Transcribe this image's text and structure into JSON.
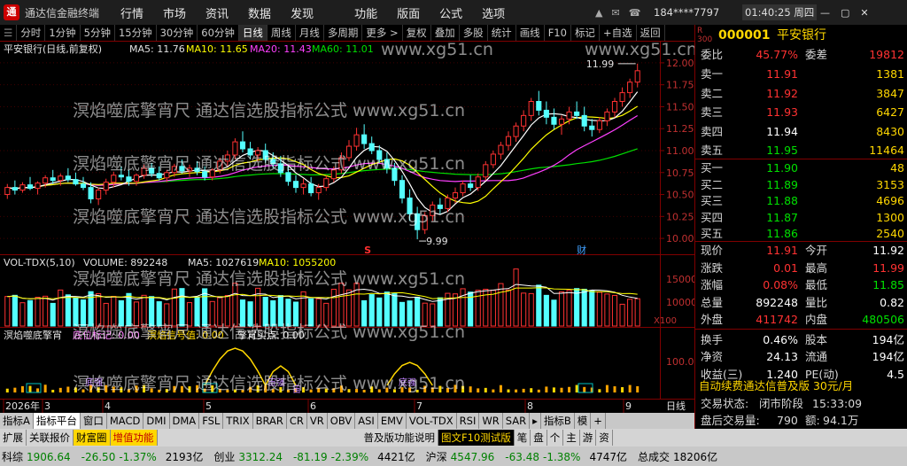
{
  "app": {
    "logo": "通",
    "title": "通达信金融终端",
    "menu": [
      "行情",
      "市场",
      "资讯",
      "数据",
      "发现",
      "功能",
      "版面",
      "公式",
      "选项"
    ],
    "account": "184****7797",
    "time": "01:40:25 周四"
  },
  "toolbar": {
    "buttons": [
      "分时",
      "1分钟",
      "5分钟",
      "15分钟",
      "30分钟",
      "60分钟",
      "日线",
      "周线",
      "月线",
      "多周期",
      "更多 >",
      "复权",
      "叠加",
      "多股",
      "统计",
      "画线",
      "F10",
      "标记",
      "+自选",
      "返回"
    ],
    "active": "日线"
  },
  "chart": {
    "header": "平安银行(日线,前复权)",
    "ma5": "MA5: 11.76",
    "ma10": "MA10: 11.65",
    "ma20": "MA20: 11.43",
    "ma60": "MA60: 11.01",
    "y_ticks": [
      "12.00",
      "11.75",
      "11.50",
      "11.25",
      "11.00",
      "10.75",
      "10.50",
      "10.25",
      "10.00"
    ],
    "high_label": "11.99",
    "low_label": "9.99",
    "marker_s": "S",
    "marker_cai": "财",
    "vol_header": "VOL-TDX(5,10)",
    "vol_value": "VOLUME: 892248",
    "vol_ma5": "MA5: 1027619",
    "vol_ma10": "MA10: 1055200",
    "vol_ticks": [
      "15000",
      "10000",
      "X100"
    ],
    "ind_header": "溟焰噬底擎宵",
    "ind_p1": "底位标记: 0.00",
    "ind_p2": "溟焰信号值: 0.00",
    "ind_p3": "擎宵买点: 0.00",
    "ind_ticks": [
      "100.0"
    ],
    "x_labels": [
      "2026年",
      "3",
      "4",
      "5",
      "6",
      "7",
      "8",
      "9"
    ],
    "x_right": "日线",
    "ind_tags": [
      "底强",
      "宙强",
      "宙",
      "底强"
    ]
  },
  "watermark": {
    "text": "溟焰噬底擎宵尺 通达信选股指标公式 www.xg51.cn",
    "short": "www.xg51.cn"
  },
  "chart_data": {
    "type": "candlestick",
    "title": "平安银行(日线,前复权)",
    "ylim": [
      9.9,
      12.1
    ],
    "ma": {
      "MA5": 11.76,
      "MA10": 11.65,
      "MA20": 11.43,
      "MA60": 11.01
    },
    "ohlc": [
      [
        10.5,
        10.62,
        10.45,
        10.58
      ],
      [
        10.58,
        10.66,
        10.5,
        10.55
      ],
      [
        10.55,
        10.64,
        10.52,
        10.61
      ],
      [
        10.61,
        10.7,
        10.55,
        10.57
      ],
      [
        10.57,
        10.65,
        10.5,
        10.63
      ],
      [
        10.63,
        10.72,
        10.58,
        10.69
      ],
      [
        10.69,
        10.78,
        10.62,
        10.66
      ],
      [
        10.66,
        10.74,
        10.6,
        10.71
      ],
      [
        10.71,
        10.8,
        10.64,
        10.67
      ],
      [
        10.67,
        10.75,
        10.6,
        10.62
      ],
      [
        10.62,
        10.7,
        10.55,
        10.58
      ],
      [
        10.58,
        10.64,
        10.4,
        10.45
      ],
      [
        10.45,
        10.58,
        10.38,
        10.55
      ],
      [
        10.55,
        10.68,
        10.5,
        10.64
      ],
      [
        10.64,
        10.76,
        10.58,
        10.72
      ],
      [
        10.72,
        10.82,
        10.66,
        10.7
      ],
      [
        10.7,
        10.78,
        10.6,
        10.65
      ],
      [
        10.65,
        10.74,
        10.6,
        10.72
      ],
      [
        10.72,
        10.84,
        10.68,
        10.8
      ],
      [
        10.8,
        10.86,
        10.7,
        10.74
      ],
      [
        10.74,
        10.82,
        10.66,
        10.69
      ],
      [
        10.69,
        10.78,
        10.64,
        10.75
      ],
      [
        10.75,
        10.85,
        10.7,
        10.82
      ],
      [
        10.82,
        10.9,
        10.74,
        10.77
      ],
      [
        10.77,
        10.84,
        10.7,
        10.8
      ],
      [
        10.8,
        10.88,
        10.72,
        10.76
      ],
      [
        10.76,
        10.82,
        10.66,
        10.7
      ],
      [
        10.7,
        10.8,
        10.66,
        10.78
      ],
      [
        10.78,
        10.92,
        10.74,
        10.88
      ],
      [
        10.88,
        11.0,
        10.82,
        10.95
      ],
      [
        10.95,
        11.14,
        10.9,
        11.1
      ],
      [
        11.1,
        11.22,
        10.98,
        11.02
      ],
      [
        11.02,
        11.1,
        10.9,
        10.95
      ],
      [
        10.95,
        11.04,
        10.88,
        11.0
      ],
      [
        11.0,
        11.08,
        10.86,
        10.9
      ],
      [
        10.9,
        10.98,
        10.8,
        10.85
      ],
      [
        10.85,
        10.94,
        10.7,
        10.75
      ],
      [
        10.75,
        10.82,
        10.6,
        10.65
      ],
      [
        10.65,
        10.72,
        10.52,
        10.58
      ],
      [
        10.58,
        10.68,
        10.5,
        10.62
      ],
      [
        10.62,
        10.7,
        10.48,
        10.52
      ],
      [
        10.52,
        10.62,
        10.44,
        10.58
      ],
      [
        10.58,
        10.72,
        10.54,
        10.68
      ],
      [
        10.68,
        10.82,
        10.64,
        10.78
      ],
      [
        10.78,
        10.98,
        10.74,
        10.92
      ],
      [
        10.92,
        11.12,
        10.88,
        11.05
      ],
      [
        11.05,
        11.26,
        11.0,
        11.18
      ],
      [
        11.18,
        11.3,
        11.02,
        11.08
      ],
      [
        11.08,
        11.16,
        10.96,
        11.0
      ],
      [
        11.0,
        11.06,
        10.86,
        10.9
      ],
      [
        10.9,
        10.98,
        10.74,
        10.8
      ],
      [
        10.8,
        10.86,
        10.6,
        10.66
      ],
      [
        10.66,
        10.72,
        10.4,
        10.46
      ],
      [
        10.46,
        10.56,
        10.2,
        10.28
      ],
      [
        10.28,
        10.36,
        9.99,
        10.1
      ],
      [
        10.1,
        10.3,
        10.05,
        10.26
      ],
      [
        10.26,
        10.42,
        10.2,
        10.38
      ],
      [
        10.38,
        10.46,
        10.28,
        10.34
      ],
      [
        10.34,
        10.5,
        10.3,
        10.46
      ],
      [
        10.46,
        10.58,
        10.4,
        10.52
      ],
      [
        10.52,
        10.66,
        10.48,
        10.62
      ],
      [
        10.62,
        10.72,
        10.54,
        10.58
      ],
      [
        10.58,
        10.74,
        10.54,
        10.7
      ],
      [
        10.7,
        10.88,
        10.66,
        10.84
      ],
      [
        10.84,
        11.0,
        10.8,
        10.96
      ],
      [
        10.96,
        11.1,
        10.9,
        11.06
      ],
      [
        11.06,
        11.22,
        11.0,
        11.16
      ],
      [
        11.16,
        11.32,
        11.1,
        11.28
      ],
      [
        11.28,
        11.46,
        11.22,
        11.4
      ],
      [
        11.4,
        11.6,
        11.34,
        11.56
      ],
      [
        11.56,
        11.68,
        11.4,
        11.46
      ],
      [
        11.46,
        11.56,
        11.3,
        11.38
      ],
      [
        11.38,
        11.48,
        11.24,
        11.3
      ],
      [
        11.3,
        11.4,
        11.18,
        11.36
      ],
      [
        11.36,
        11.5,
        11.3,
        11.44
      ],
      [
        11.44,
        11.56,
        11.36,
        11.4
      ],
      [
        11.4,
        11.5,
        11.22,
        11.28
      ],
      [
        11.28,
        11.36,
        11.16,
        11.24
      ],
      [
        11.24,
        11.38,
        11.2,
        11.34
      ],
      [
        11.34,
        11.48,
        11.28,
        11.44
      ],
      [
        11.44,
        11.6,
        11.38,
        11.56
      ],
      [
        11.56,
        11.72,
        11.5,
        11.66
      ],
      [
        11.66,
        11.82,
        11.6,
        11.78
      ],
      [
        11.78,
        11.99,
        11.72,
        11.91
      ]
    ]
  },
  "quote": {
    "code": "000001",
    "name": "平安银行",
    "weibi_label": "委比",
    "weibi": "45.77%",
    "weicha_label": "委差",
    "weicha": "19812",
    "sell": [
      {
        "label": "卖五",
        "price": "11.95",
        "vol": "11464"
      },
      {
        "label": "卖四",
        "price": "11.94",
        "vol": "8430"
      },
      {
        "label": "卖三",
        "price": "11.93",
        "vol": "6427"
      },
      {
        "label": "卖二",
        "price": "11.92",
        "vol": "3847"
      },
      {
        "label": "卖一",
        "price": "11.91",
        "vol": "1381"
      }
    ],
    "buy": [
      {
        "label": "买一",
        "price": "11.90",
        "vol": "48"
      },
      {
        "label": "买二",
        "price": "11.89",
        "vol": "3153"
      },
      {
        "label": "买三",
        "price": "11.88",
        "vol": "4696"
      },
      {
        "label": "买四",
        "price": "11.87",
        "vol": "1300"
      },
      {
        "label": "买五",
        "price": "11.86",
        "vol": "2540"
      }
    ],
    "stats": [
      {
        "l1": "现价",
        "v1": "11.91",
        "c1": "red",
        "l2": "今开",
        "v2": "11.92",
        "c2": "wht"
      },
      {
        "l1": "涨跌",
        "v1": "0.01",
        "c1": "red",
        "l2": "最高",
        "v2": "11.99",
        "c2": "red"
      },
      {
        "l1": "涨幅",
        "v1": "0.08%",
        "c1": "red",
        "l2": "最低",
        "v2": "11.85",
        "c2": "grn"
      },
      {
        "l1": "总量",
        "v1": "892248",
        "c1": "wht",
        "l2": "量比",
        "v2": "0.82",
        "c2": "wht"
      },
      {
        "l1": "外盘",
        "v1": "411742",
        "c1": "red",
        "l2": "内盘",
        "v2": "480506",
        "c2": "grn"
      },
      {
        "l1": "换手",
        "v1": "0.46%",
        "c1": "wht",
        "l2": "股本",
        "v2": "194亿",
        "c2": "wht"
      },
      {
        "l1": "净资",
        "v1": "24.13",
        "c1": "wht",
        "l2": "流通",
        "v2": "194亿",
        "c2": "wht"
      },
      {
        "l1": "收益(三)",
        "v1": "1.240",
        "c1": "wht",
        "l2": "PE(动)",
        "v2": "4.5",
        "c2": "wht"
      }
    ],
    "notice": "自动续费通达信普及版 30元/月",
    "trade_state_label": "交易状态:",
    "trade_state": "闭市阶段",
    "trade_time": "15:33:09",
    "after_label": "盘后交易量:",
    "after_vol": "790",
    "after_amt_label": "额:",
    "after_amt": "94.1万"
  },
  "tabs1": [
    "指标A",
    "指标平台",
    "窗口",
    "MACD",
    "DMI",
    "DMA",
    "FSL",
    "TRIX",
    "BRAR",
    "CR",
    "VR",
    "OBV",
    "ASI",
    "EMV",
    "VOL-TDX",
    "RSI",
    "WR",
    "SAR",
    "▸",
    "指标B",
    "模",
    "+"
  ],
  "tabs2": [
    "扩展",
    "关联报价",
    "财富圈",
    "增值功能",
    "普及版功能说明",
    "图文F10测试版",
    "笔",
    "盘",
    "个",
    "主",
    "游",
    "资"
  ],
  "status": [
    {
      "n": "科综",
      "v": "1906.64",
      "c": "-26.50",
      "p": "-1.37%",
      "a": "2193亿"
    },
    {
      "n": "创业",
      "v": "3312.24",
      "c": "-81.19",
      "p": "-2.39%",
      "a": "4421亿"
    },
    {
      "n": "沪深",
      "v": "4547.96",
      "c": "-63.48",
      "p": "-1.38%",
      "a": "4747亿"
    },
    {
      "n": "总成交",
      "v": "18206亿"
    }
  ]
}
